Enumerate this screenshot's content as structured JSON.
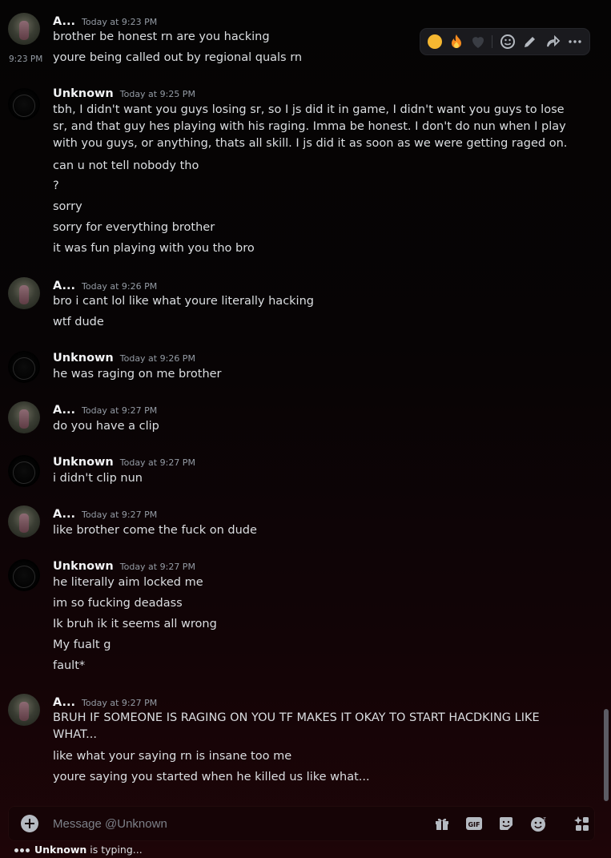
{
  "groups": [
    {
      "author": "A...",
      "avatar": "a",
      "time": "Today at 9:23 PM",
      "messages": [
        "brother be honest rn are you hacking",
        "youre being called out by regional quals rn"
      ],
      "side_time": "9:23 PM"
    },
    {
      "author": "Unknown",
      "avatar": "u",
      "time": "Today at 9:25 PM",
      "messages": [
        "tbh, I didn't want you guys losing sr, so I js did it in game, I didn't want you guys to lose sr, and that guy hes playing with his raging. Imma be honest. I don't do nun when I play with you guys, or anything, thats all skill. I js did it as soon as we were getting raged on.",
        "can u not tell nobody tho",
        "?",
        "sorry",
        "sorry for everything brother",
        "it was fun playing with you tho bro"
      ]
    },
    {
      "author": "A...",
      "avatar": "a",
      "time": "Today at 9:26 PM",
      "messages": [
        "bro i cant lol like what youre literally hacking",
        "wtf dude"
      ]
    },
    {
      "author": "Unknown",
      "avatar": "u",
      "time": "Today at 9:26 PM",
      "messages": [
        "he was raging on me brother"
      ]
    },
    {
      "author": "A...",
      "avatar": "a",
      "time": "Today at 9:27 PM",
      "messages": [
        "do you have a clip"
      ]
    },
    {
      "author": "Unknown",
      "avatar": "u",
      "time": "Today at 9:27 PM",
      "messages": [
        "i didn't clip nun"
      ]
    },
    {
      "author": "A...",
      "avatar": "a",
      "time": "Today at 9:27 PM",
      "messages": [
        "like brother come the fuck on dude"
      ]
    },
    {
      "author": "Unknown",
      "avatar": "u",
      "time": "Today at 9:27 PM",
      "messages": [
        "he literally aim locked me",
        "im so fucking deadass",
        "Ik bruh ik it seems all wrong",
        "My fualt g",
        "fault*"
      ]
    },
    {
      "author": "A...",
      "avatar": "a",
      "time": "Today at 9:27 PM",
      "messages": [
        "BRUH IF SOMEONE IS RAGING ON YOU TF MAKES IT OKAY TO START HACDKING LIKE WHAT...",
        "like what your saying rn is insane too me",
        "youre saying you started when he killed us like what..."
      ]
    }
  ],
  "hover_bar": {
    "reactions": [
      "rofl-emoji",
      "fire-emoji",
      "black-heart-emoji"
    ],
    "actions": [
      "add-reaction",
      "edit",
      "forward",
      "more"
    ]
  },
  "composer": {
    "placeholder": "Message @Unknown"
  },
  "typing": {
    "user": "Unknown",
    "suffix": " is typing..."
  },
  "colors": {
    "accent": "#dbdee1",
    "muted": "#949ba4",
    "background": "#070405"
  }
}
